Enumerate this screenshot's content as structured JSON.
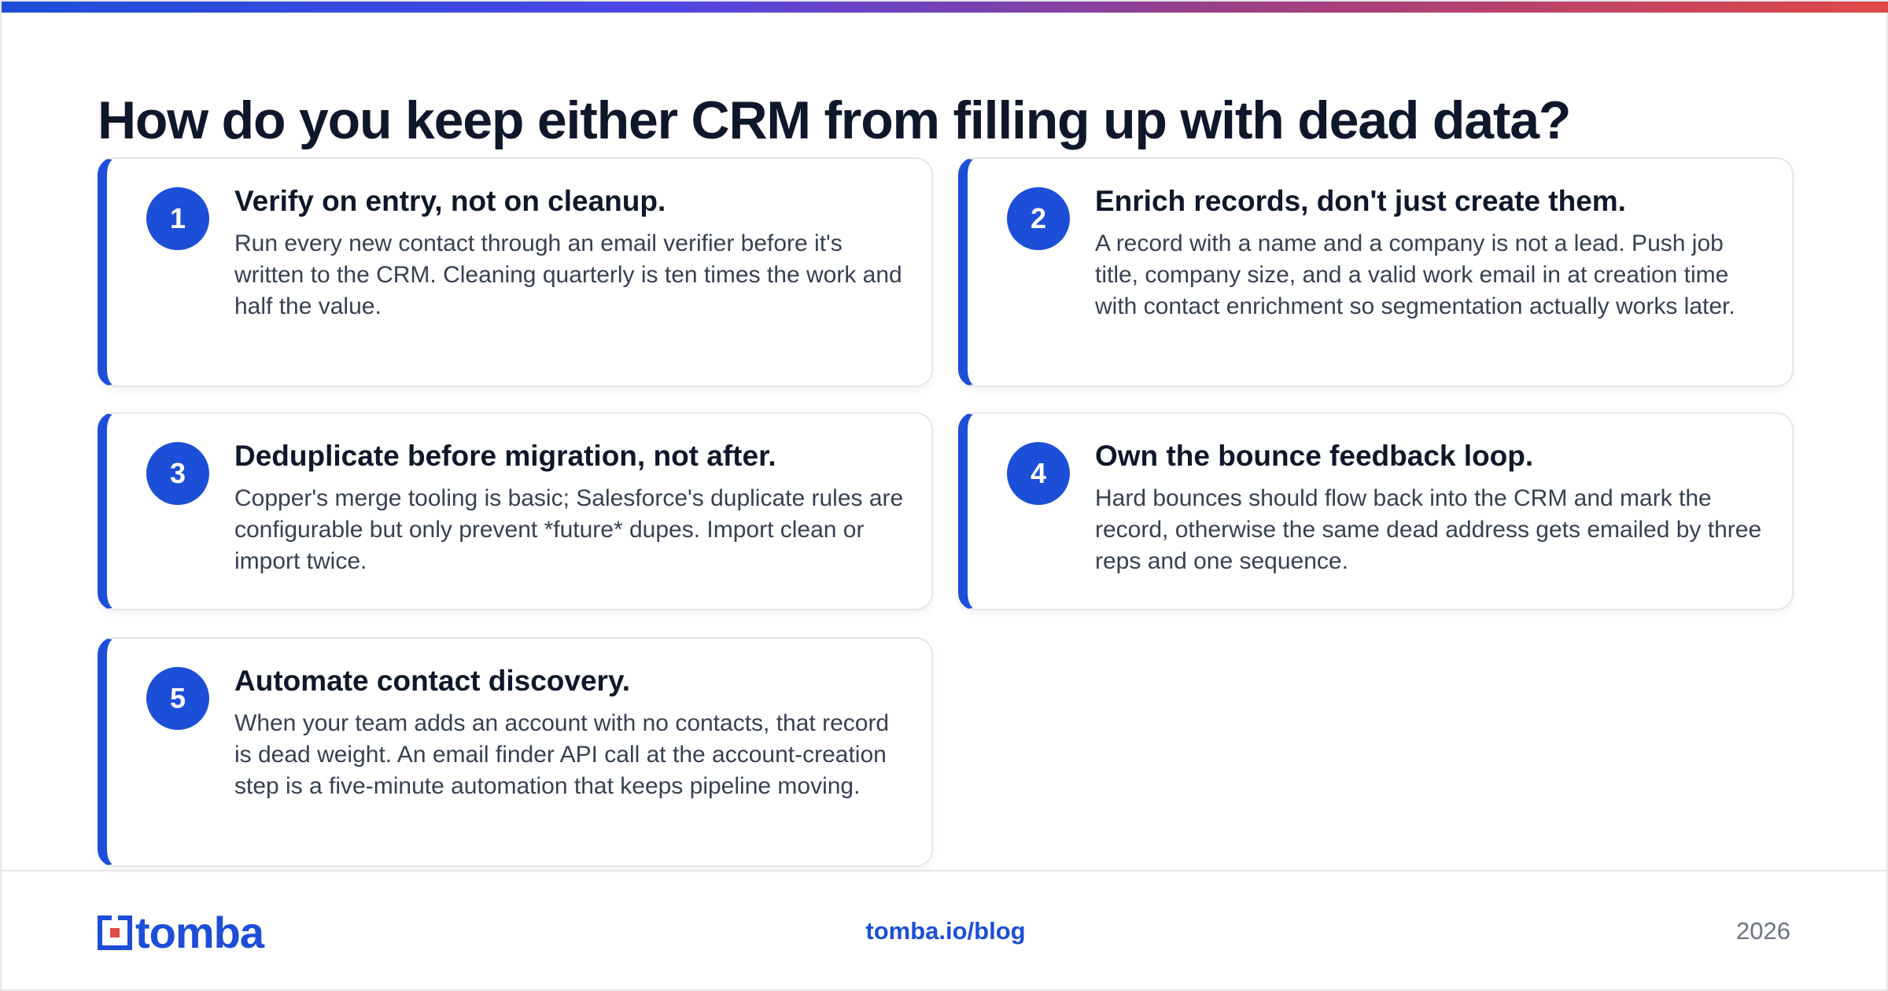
{
  "colors": {
    "accent": "#1d4ed8",
    "title": "#0f172a",
    "body_text": "#374151",
    "muted": "#6b7280",
    "gradient": [
      "#1d4ed8",
      "#4f46e5",
      "#9b3f86",
      "#e04848"
    ]
  },
  "page": {
    "title": "How do you keep either CRM from filling up with dead data?"
  },
  "tips": [
    {
      "number": "1",
      "title": "Verify on entry, not on cleanup.",
      "body": "Run every new contact through an email verifier before it's written to the CRM. Cleaning quarterly is ten times the work and half the value."
    },
    {
      "number": "2",
      "title": "Enrich records, don't just create them.",
      "body": "A record with a name and a company is not a lead. Push job title, company size, and a valid work email in at creation time with contact enrichment so segmentation actually works later."
    },
    {
      "number": "3",
      "title": "Deduplicate before migration, not after.",
      "body": "Copper's merge tooling is basic; Salesforce's duplicate rules are configurable but only prevent *future* dupes. Import clean or import twice."
    },
    {
      "number": "4",
      "title": "Own the bounce feedback loop.",
      "body": "Hard bounces should flow back into the CRM and mark the record, otherwise the same dead address gets emailed by three reps and one sequence."
    },
    {
      "number": "5",
      "title": "Automate contact discovery.",
      "body": "When your team adds an account with no contacts, that record is dead weight. An email finder API call at the account-creation step is a five-minute automation that keeps pipeline moving."
    }
  ],
  "footer": {
    "logo_text": "tomba",
    "logo_icon": "tomba-logo-icon",
    "link": "tomba.io/blog",
    "year": "2026"
  }
}
